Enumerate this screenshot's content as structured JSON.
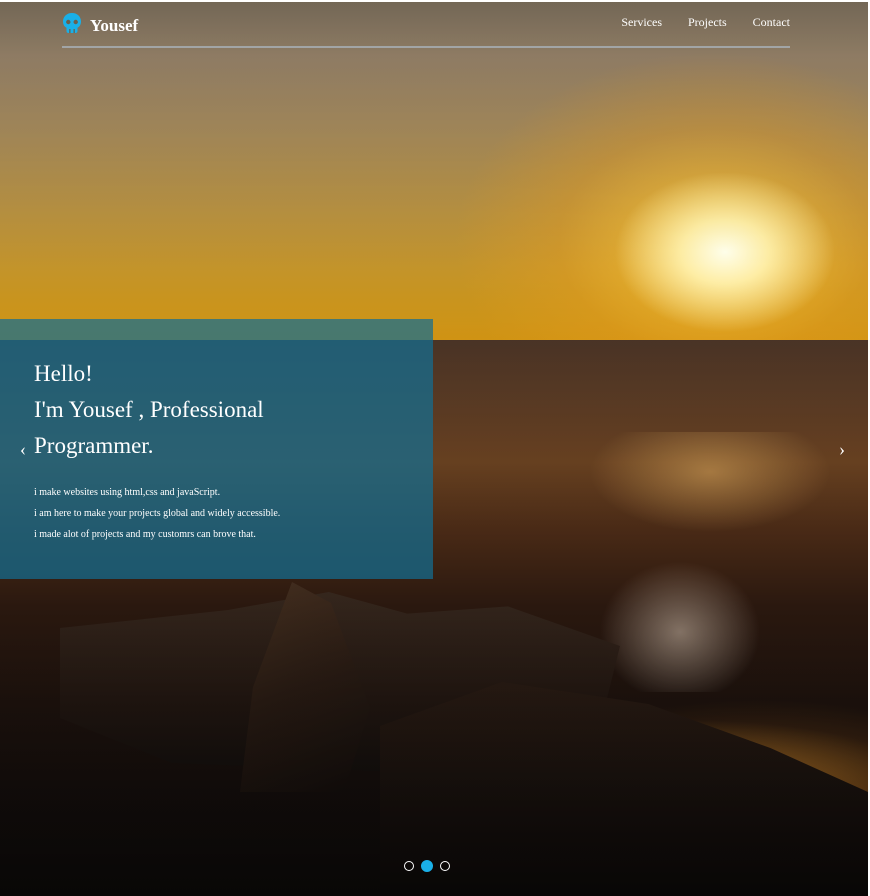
{
  "brand": {
    "name": "Yousef",
    "icon": "skull-icon",
    "icon_color": "#1ab0e8"
  },
  "nav": {
    "items": [
      "Services",
      "Projects",
      "Contact"
    ]
  },
  "hero": {
    "title_lines": [
      "Hello!",
      "I'm Yousef , Professional",
      "Programmer."
    ],
    "description_lines": [
      "i make websites using html,css and javaScript.",
      "i am here to make your projects global and widely accessible.",
      "i made alot of projects and my customrs can brove that."
    ],
    "caption_color": "#146e91"
  },
  "carousel": {
    "prev_icon": "chevron-left-icon",
    "next_icon": "chevron-right-icon",
    "slide_count": 3,
    "active_index": 1,
    "active_color": "#1ab0e8"
  }
}
